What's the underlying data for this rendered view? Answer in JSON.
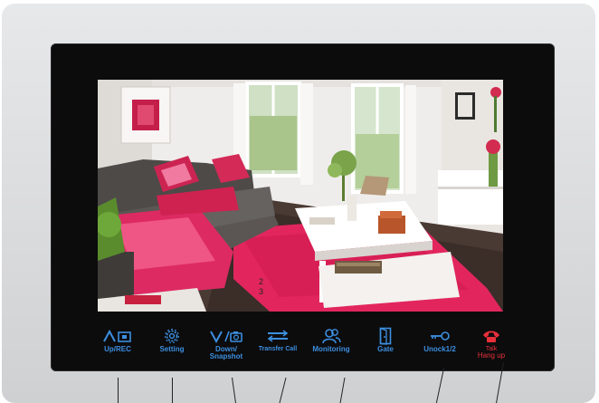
{
  "device": {
    "colors": {
      "shell": "#dcdddf",
      "bezel": "#0c0c0d",
      "button_blue": "#3d8fe0",
      "button_red": "#e8303a"
    }
  },
  "screen": {
    "overlay_marks": [
      "2",
      "3"
    ]
  },
  "buttons": [
    {
      "icon": "up-rec-icon",
      "label": "Up/REC"
    },
    {
      "icon": "gear-icon",
      "label": "Setting"
    },
    {
      "icon": "down-snapshot-icon",
      "label_line1": "Down/",
      "label_line2": "Snapshot"
    },
    {
      "icon": "transfer-arrows-icon",
      "label": "Transfer Call"
    },
    {
      "icon": "people-icon",
      "label": "Monitoring"
    },
    {
      "icon": "door-icon",
      "label": "Gate"
    },
    {
      "icon": "key-icon",
      "label": "Unock1/2"
    },
    {
      "icon": "handset-icon",
      "label_top": "Talk",
      "label": "Hang up"
    }
  ]
}
